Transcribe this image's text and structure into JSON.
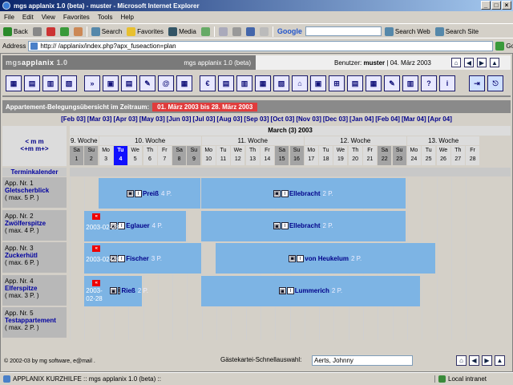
{
  "window": {
    "title": "mgs applanix 1.0 (beta) - muster - Microsoft Internet Explorer"
  },
  "menu": [
    "File",
    "Edit",
    "View",
    "Favorites",
    "Tools",
    "Help"
  ],
  "toolbar": {
    "back": "Back",
    "search": "Search",
    "favorites": "Favorites",
    "media": "Media",
    "google": "Google",
    "search_web": "Search Web",
    "search_site": "Search Site"
  },
  "address": {
    "label": "Address",
    "url": "http://                    /applanix/index.php?apx_fuseaction=plan",
    "go": "Go"
  },
  "app": {
    "logo_a": "mgs",
    "logo_b": "applanix",
    "logo_c": "1.0",
    "version": "mgs applanix 1.0 (beta)",
    "user_label": "Benutzer:",
    "user": "muster",
    "date": "04. März 2003"
  },
  "plan": {
    "title": "Appartement-Belegungsübersicht im Zeitraum:",
    "range": "01. März 2003 bis 28. März 2003"
  },
  "months": [
    "[Feb 03]",
    "[Mar 03]",
    "[Apr 03]",
    "[May 03]",
    "[Jun 03]",
    "[Jul 03]",
    "[Aug 03]",
    "[Sep 03]",
    "[Oct 03]",
    "[Nov 03]",
    "[Dec 03]",
    "[Jan 04]",
    "[Feb 04]",
    "[Mar 04]",
    "[Apr 04]"
  ],
  "nav": {
    "m_prev": "< m m",
    "m_next": "<+m m+>",
    "month_head": "March (3) 2003",
    "calendar": "Terminkalender"
  },
  "weeks": [
    "9. Woche",
    "10. Woche",
    "11. Woche",
    "12. Woche",
    "13. Woche"
  ],
  "days": [
    {
      "d": "Sa",
      "n": "1"
    },
    {
      "d": "Su",
      "n": "2"
    },
    {
      "d": "Mo",
      "n": "3"
    },
    {
      "d": "Tu",
      "n": "4"
    },
    {
      "d": "We",
      "n": "5"
    },
    {
      "d": "Th",
      "n": "6"
    },
    {
      "d": "Fr",
      "n": "7"
    },
    {
      "d": "Sa",
      "n": "8"
    },
    {
      "d": "Su",
      "n": "9"
    },
    {
      "d": "Mo",
      "n": "10"
    },
    {
      "d": "Tu",
      "n": "11"
    },
    {
      "d": "We",
      "n": "12"
    },
    {
      "d": "Th",
      "n": "13"
    },
    {
      "d": "Fr",
      "n": "14"
    },
    {
      "d": "Sa",
      "n": "15"
    },
    {
      "d": "Su",
      "n": "16"
    },
    {
      "d": "Mo",
      "n": "17"
    },
    {
      "d": "Tu",
      "n": "18"
    },
    {
      "d": "We",
      "n": "19"
    },
    {
      "d": "Th",
      "n": "20"
    },
    {
      "d": "Fr",
      "n": "21"
    },
    {
      "d": "Sa",
      "n": "22"
    },
    {
      "d": "Su",
      "n": "23"
    },
    {
      "d": "Mo",
      "n": "24"
    },
    {
      "d": "Tu",
      "n": "25"
    },
    {
      "d": "We",
      "n": "26"
    },
    {
      "d": "Th",
      "n": "27"
    },
    {
      "d": "Fr",
      "n": "28"
    }
  ],
  "apartments": [
    {
      "nr": "App. Nr. 1",
      "name": "Gletscherblick",
      "max": "( max. 5 P. )"
    },
    {
      "nr": "App. Nr. 2",
      "name": "Zwölferspitze",
      "max": "( max. 4 P. )"
    },
    {
      "nr": "App. Nr. 3",
      "name": "Zuckerhütl",
      "max": "( max. 6 P. )"
    },
    {
      "nr": "App. Nr. 4",
      "name": "Elferspitze",
      "max": "( max. 3 P. )"
    },
    {
      "nr": "App. Nr. 5",
      "name": "Testappartement",
      "max": "( max. 2 P. )"
    }
  ],
  "bookings": [
    {
      "row": 0,
      "start": 2,
      "end": 9,
      "guest": "Preiß",
      "persons": "4 P."
    },
    {
      "row": 0,
      "start": 9,
      "end": 23,
      "guest": "Ellebracht",
      "persons": "2 P."
    },
    {
      "row": 1,
      "start": 1,
      "end": 8,
      "guest": "Eglauer",
      "persons": "4 P.",
      "since": "2003-02-28"
    },
    {
      "row": 1,
      "start": 9,
      "end": 23,
      "guest": "Ellebracht",
      "persons": "2 P."
    },
    {
      "row": 2,
      "start": 1,
      "end": 9,
      "guest": "Fischer",
      "persons": "3 P.",
      "since": "2003-02-28"
    },
    {
      "row": 2,
      "start": 10,
      "end": 25,
      "guest": "von Heukelum",
      "persons": "2 P."
    },
    {
      "row": 3,
      "start": 1,
      "end": 5,
      "guest": "Rieß",
      "persons": "2 P.",
      "since": "2003-02-28"
    },
    {
      "row": 3,
      "start": 9,
      "end": 24,
      "guest": "Lummerich",
      "persons": "2 P."
    }
  ],
  "footer": {
    "copyright": "© 2002-03 by mg software, e@mail .",
    "quick_label": "Gästekartei-Schnellauswahl:",
    "quick_value": "Aerts, Johnny"
  },
  "status": {
    "text": "APPLANIX KURZHILFE :: mgs applanix 1.0 (beta) ::",
    "zone": "Local intranet"
  }
}
